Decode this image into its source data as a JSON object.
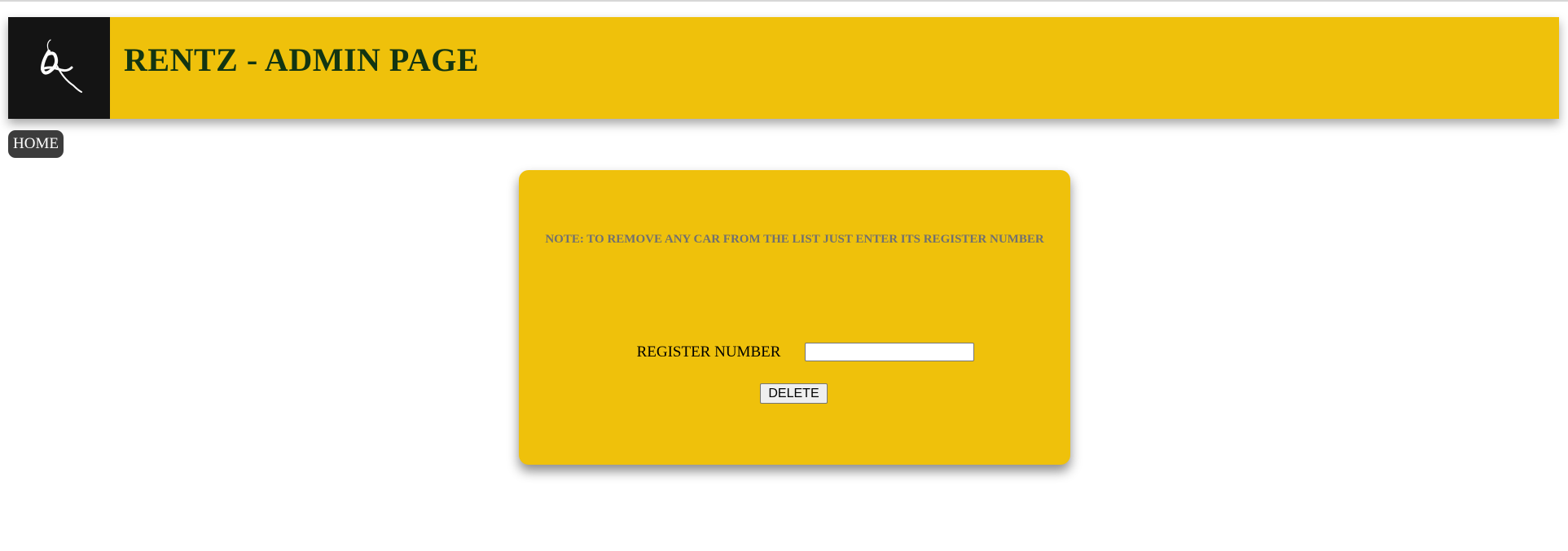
{
  "header": {
    "logo_icon": "rentz-logo-icon",
    "title": "RENTZ - ADMIN PAGE",
    "background_color": "#efc10b",
    "title_color": "#123512"
  },
  "nav": {
    "home_label": "HOME"
  },
  "card": {
    "note": "NOTE: TO REMOVE ANY CAR FROM THE LIST JUST ENTER ITS REGISTER NUMBER",
    "register_label": "REGISTER NUMBER",
    "register_value": "",
    "register_placeholder": "",
    "delete_label": "DELETE"
  }
}
